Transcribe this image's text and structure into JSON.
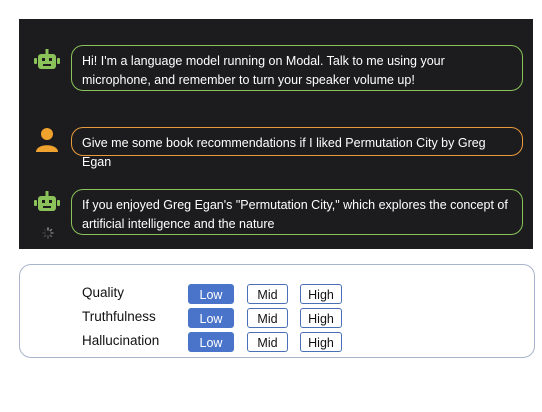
{
  "chat": {
    "messages": [
      {
        "role": "bot",
        "avatar_icon": "robot-icon",
        "text": "Hi! I'm a language model running on Modal. Talk to me using your microphone, and remember to turn your speaker volume up!"
      },
      {
        "role": "user",
        "avatar_icon": "user-icon",
        "text": "Give me some book recommendations if I liked Permutation City by Greg Egan"
      },
      {
        "role": "bot",
        "avatar_icon": "robot-icon",
        "text": "If you enjoyed Greg Egan's \"Permutation City,\" which explores the concept of artificial intelligence and the nature",
        "loading": true
      }
    ],
    "colors": {
      "background": "#1c1c1e",
      "bot_border": "#8bc25a",
      "user_border": "#e89a3c",
      "user_avatar": "#f0a22e"
    }
  },
  "rating": {
    "options": [
      "Low",
      "Mid",
      "High"
    ],
    "rows": [
      {
        "label": "Quality",
        "selected": "Low"
      },
      {
        "label": "Truthfulness",
        "selected": "Low"
      },
      {
        "label": "Hallucination",
        "selected": "Low"
      }
    ],
    "colors": {
      "selected": "#4a74c9",
      "border": "#a8b4cc"
    }
  }
}
